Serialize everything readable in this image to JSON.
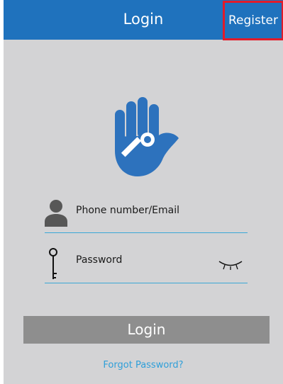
{
  "header": {
    "title": "Login",
    "register_label": "Register"
  },
  "form": {
    "username_placeholder": "Phone number/Email",
    "password_placeholder": "Password"
  },
  "login_button_label": "Login",
  "forgot_password_label": "Forgot Password?",
  "icons": {
    "logo": "hand-key-icon",
    "user": "user-icon",
    "password": "key-icon",
    "toggle": "eye-closed-icon"
  },
  "colors": {
    "header_bg": "#1f72bd",
    "page_bg": "#d3d3d5",
    "register_highlight": "#e21b2a",
    "accent_line": "#3aa7d6",
    "link": "#2e9fd9",
    "button_bg": "#8e8e8e"
  }
}
